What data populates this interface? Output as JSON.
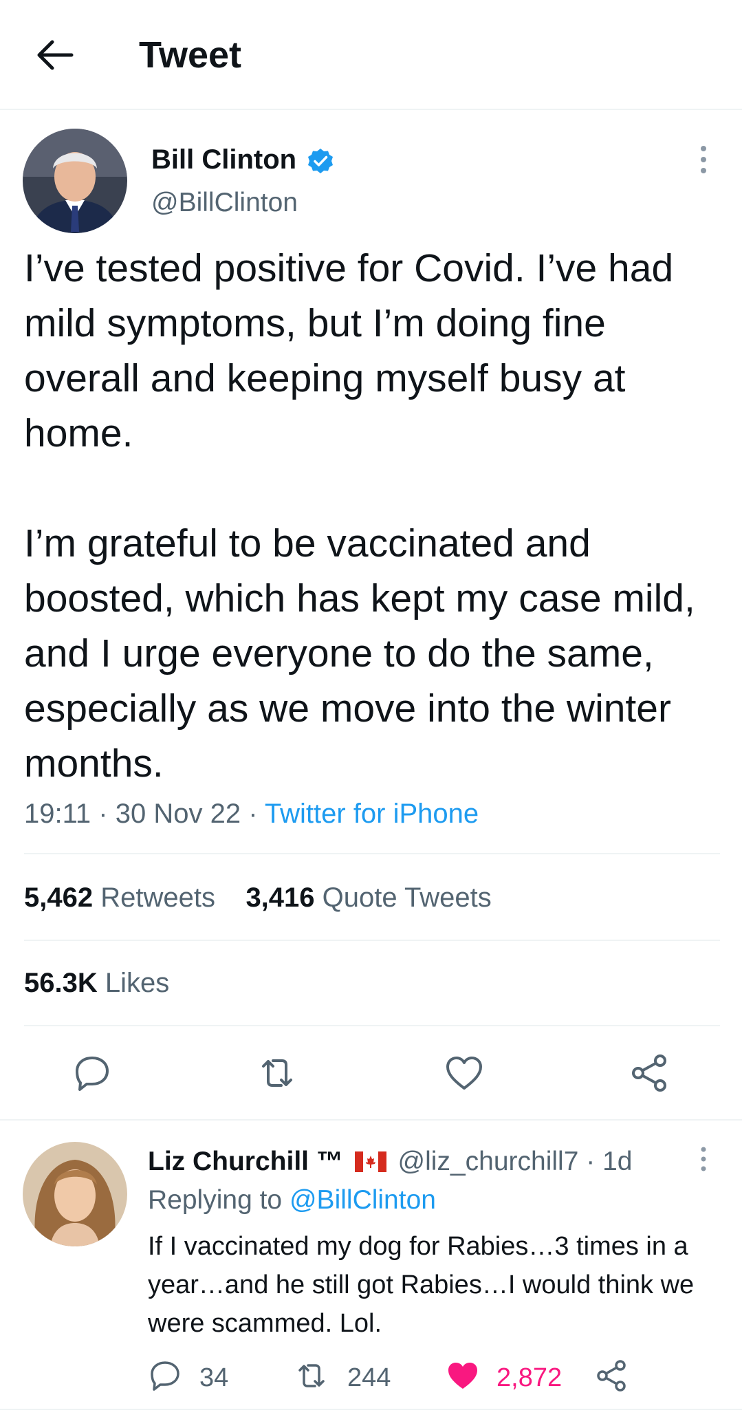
{
  "header": {
    "title": "Tweet"
  },
  "tweet": {
    "author_name": "Bill Clinton",
    "author_handle": "@BillClinton",
    "text": "I’ve tested positive for Covid. I’ve had mild symptoms, but I’m doing fine overall and keeping myself busy at home.\n\nI’m grateful to be vaccinated and boosted, which has kept my case mild, and I urge everyone to do the same, especially as we move into the winter months.",
    "time": "19:11",
    "date": "30 Nov 22",
    "separator": "·",
    "source": "Twitter for iPhone",
    "retweets_count": "5,462",
    "retweets_label": "Retweets",
    "quotes_count": "3,416",
    "quotes_label": "Quote Tweets",
    "likes_count": "56.3K",
    "likes_label": "Likes"
  },
  "reply": {
    "author_name": "Liz Churchill ™",
    "author_handle": "@liz_churchill7",
    "age": "1d",
    "replying_prefix": "Replying to",
    "replying_to": "@BillClinton",
    "text": "If I vaccinated my dog for Rabies…3 times in a year…and he still got Rabies…I would think we were scammed. Lol.",
    "reply_count": "34",
    "retweet_count": "244",
    "like_count": "2,872"
  },
  "colors": {
    "accent": "#1d9bf0",
    "like": "#f91880",
    "secondary_text": "#536471",
    "divider": "#eff3f4"
  },
  "icons": [
    "back-arrow-icon",
    "verified-badge-icon",
    "more-icon",
    "reply-icon",
    "retweet-icon",
    "like-icon",
    "share-icon",
    "canada-flag-icon"
  ]
}
